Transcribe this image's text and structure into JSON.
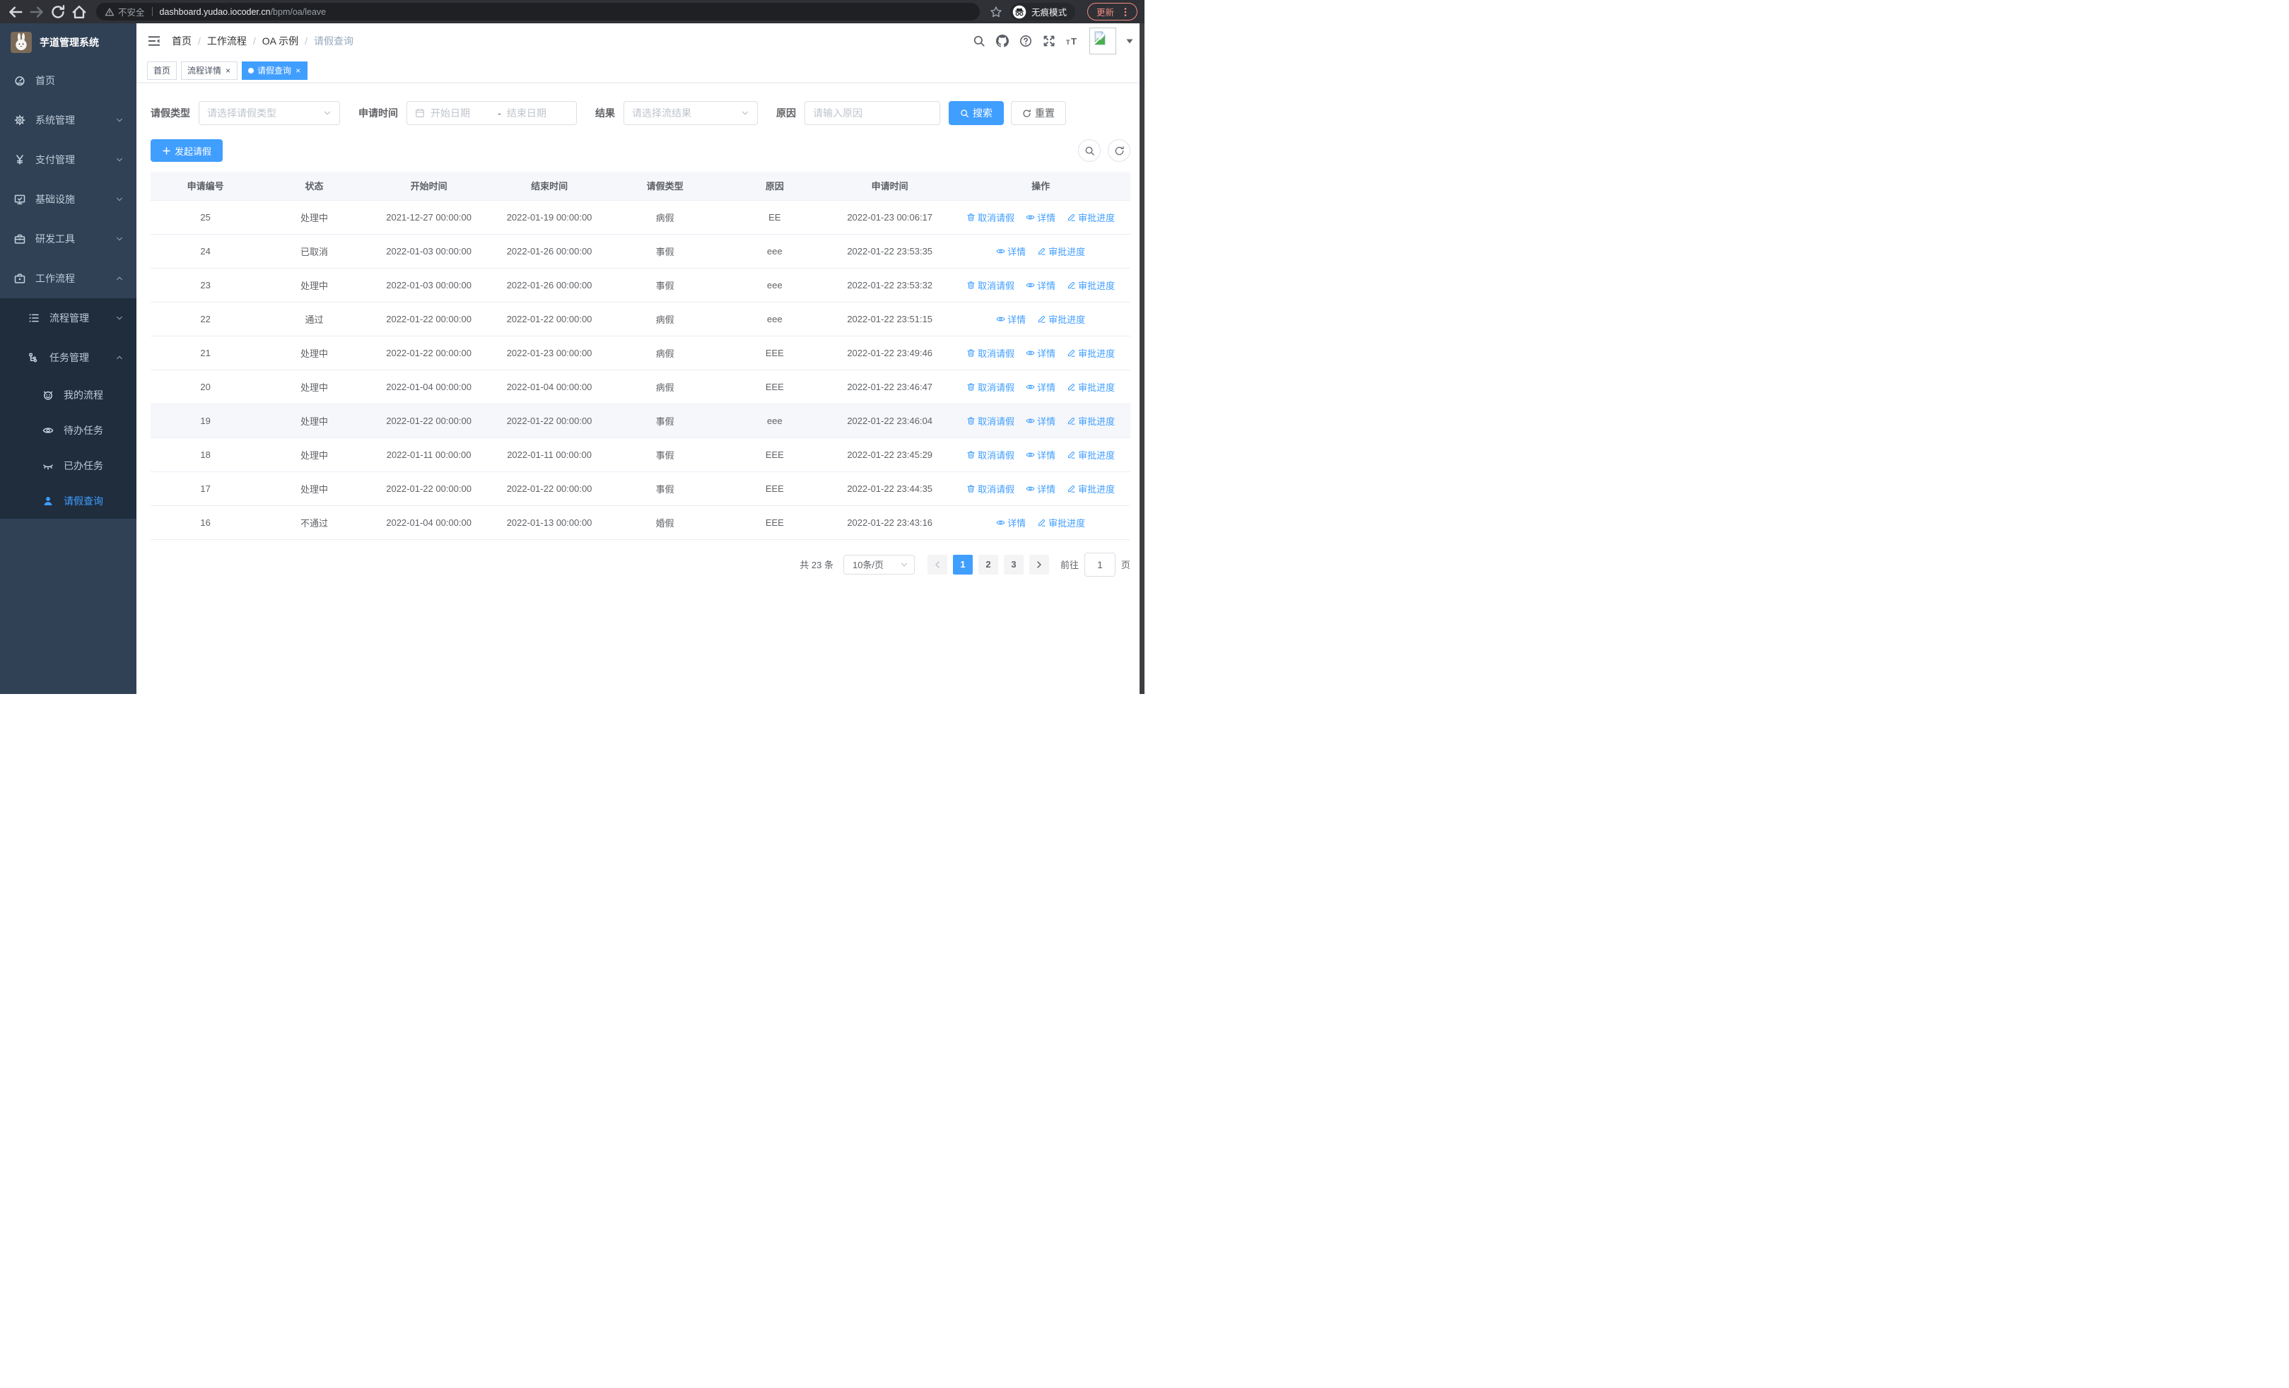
{
  "colors": {
    "accent": "#409eff",
    "sidebar_bg": "#304156",
    "submenu_bg": "#1f2d3d",
    "update_chip": "#f28b82"
  },
  "browser": {
    "security_label": "不安全",
    "url_domain": "dashboard.yudao.iocoder.cn",
    "url_path": "/bpm/oa/leave",
    "incognito_label": "无痕模式",
    "update_label": "更新"
  },
  "sidebar": {
    "title": "芋道管理系统",
    "items": [
      {
        "id": "home",
        "label": "首页",
        "icon": "dashboard-icon",
        "level": 1
      },
      {
        "id": "system-mgmt",
        "label": "系统管理",
        "icon": "gear-icon",
        "level": 1,
        "chevron": "down"
      },
      {
        "id": "pay-mgmt",
        "label": "支付管理",
        "icon": "yen-icon",
        "level": 1,
        "chevron": "down"
      },
      {
        "id": "infrastructure",
        "label": "基础设施",
        "icon": "monitor-icon",
        "level": 1,
        "chevron": "down"
      },
      {
        "id": "dev-tools",
        "label": "研发工具",
        "icon": "toolbox-icon",
        "level": 1,
        "chevron": "down"
      },
      {
        "id": "workflow",
        "label": "工作流程",
        "icon": "briefcase-icon",
        "level": 1,
        "chevron": "up"
      },
      {
        "id": "process-mgmt",
        "label": "流程管理",
        "icon": "flow-list-icon",
        "level": 2,
        "chevron": "down",
        "dark": true
      },
      {
        "id": "task-mgmt",
        "label": "任务管理",
        "icon": "tree-icon",
        "level": 2,
        "chevron": "up",
        "dark": true
      },
      {
        "id": "my-process",
        "label": "我的流程",
        "icon": "robot-icon",
        "level": 3,
        "dark": true
      },
      {
        "id": "todo-task",
        "label": "待办任务",
        "icon": "eye-icon",
        "level": 3,
        "dark": true
      },
      {
        "id": "done-task",
        "label": "已办任务",
        "icon": "eye-closed-icon",
        "level": 3,
        "dark": true
      },
      {
        "id": "leave-query",
        "label": "请假查询",
        "icon": "user-icon",
        "level": 3,
        "dark": true,
        "active": true
      }
    ]
  },
  "navbar": {
    "breadcrumb": [
      "首页",
      "工作流程",
      "OA 示例",
      "请假查询"
    ],
    "separator": "/"
  },
  "tabs": [
    {
      "label": "首页",
      "closable": false,
      "active": false
    },
    {
      "label": "流程详情",
      "closable": true,
      "active": false
    },
    {
      "label": "请假查询",
      "closable": true,
      "active": true
    }
  ],
  "tab_close_glyph": "×",
  "filters": {
    "leave_type": {
      "label": "请假类型",
      "placeholder": "请选择请假类型"
    },
    "apply_time": {
      "label": "申请时间",
      "start_placeholder": "开始日期",
      "separator": "-",
      "end_placeholder": "结束日期"
    },
    "result": {
      "label": "结果",
      "placeholder": "请选择流结果"
    },
    "reason": {
      "label": "原因",
      "placeholder": "请输入原因"
    },
    "search_label": "搜索",
    "reset_label": "重置"
  },
  "toolbar": {
    "create_label": "发起请假"
  },
  "table": {
    "columns": [
      "申请编号",
      "状态",
      "开始时间",
      "结束时间",
      "请假类型",
      "原因",
      "申请时间",
      "操作"
    ],
    "action_defs": {
      "cancel": {
        "name": "cancel-leave-link",
        "icon": "trash-icon",
        "label": "取消请假"
      },
      "detail": {
        "name": "detail-link",
        "icon": "view-icon",
        "label": "详情"
      },
      "progress": {
        "name": "approval-progress-link",
        "icon": "edit-icon",
        "label": "审批进度"
      }
    },
    "rows": [
      {
        "id": "25",
        "status": "处理中",
        "start": "2021-12-27 00:00:00",
        "end": "2022-01-19 00:00:00",
        "type": "病假",
        "reason": "EE",
        "apply_time": "2022-01-23 00:06:17",
        "actions": [
          "cancel",
          "detail",
          "progress"
        ]
      },
      {
        "id": "24",
        "status": "已取消",
        "start": "2022-01-03 00:00:00",
        "end": "2022-01-26 00:00:00",
        "type": "事假",
        "reason": "eee",
        "apply_time": "2022-01-22 23:53:35",
        "actions": [
          "detail",
          "progress"
        ]
      },
      {
        "id": "23",
        "status": "处理中",
        "start": "2022-01-03 00:00:00",
        "end": "2022-01-26 00:00:00",
        "type": "事假",
        "reason": "eee",
        "apply_time": "2022-01-22 23:53:32",
        "actions": [
          "cancel",
          "detail",
          "progress"
        ]
      },
      {
        "id": "22",
        "status": "通过",
        "start": "2022-01-22 00:00:00",
        "end": "2022-01-22 00:00:00",
        "type": "病假",
        "reason": "eee",
        "apply_time": "2022-01-22 23:51:15",
        "actions": [
          "detail",
          "progress"
        ]
      },
      {
        "id": "21",
        "status": "处理中",
        "start": "2022-01-22 00:00:00",
        "end": "2022-01-23 00:00:00",
        "type": "病假",
        "reason": "EEE",
        "apply_time": "2022-01-22 23:49:46",
        "actions": [
          "cancel",
          "detail",
          "progress"
        ]
      },
      {
        "id": "20",
        "status": "处理中",
        "start": "2022-01-04 00:00:00",
        "end": "2022-01-04 00:00:00",
        "type": "病假",
        "reason": "EEE",
        "apply_time": "2022-01-22 23:46:47",
        "actions": [
          "cancel",
          "detail",
          "progress"
        ]
      },
      {
        "id": "19",
        "status": "处理中",
        "start": "2022-01-22 00:00:00",
        "end": "2022-01-22 00:00:00",
        "type": "事假",
        "reason": "eee",
        "apply_time": "2022-01-22 23:46:04",
        "actions": [
          "cancel",
          "detail",
          "progress"
        ],
        "highlighted": true
      },
      {
        "id": "18",
        "status": "处理中",
        "start": "2022-01-11 00:00:00",
        "end": "2022-01-11 00:00:00",
        "type": "事假",
        "reason": "EEE",
        "apply_time": "2022-01-22 23:45:29",
        "actions": [
          "cancel",
          "detail",
          "progress"
        ]
      },
      {
        "id": "17",
        "status": "处理中",
        "start": "2022-01-22 00:00:00",
        "end": "2022-01-22 00:00:00",
        "type": "事假",
        "reason": "EEE",
        "apply_time": "2022-01-22 23:44:35",
        "actions": [
          "cancel",
          "detail",
          "progress"
        ]
      },
      {
        "id": "16",
        "status": "不通过",
        "start": "2022-01-04 00:00:00",
        "end": "2022-01-13 00:00:00",
        "type": "婚假",
        "reason": "EEE",
        "apply_time": "2022-01-22 23:43:16",
        "actions": [
          "detail",
          "progress"
        ]
      }
    ]
  },
  "pagination": {
    "total_label": "共 23 条",
    "page_size_label": "10条/页",
    "pages": [
      "1",
      "2",
      "3"
    ],
    "active_page": "1",
    "goto_label": "前往",
    "goto_value": "1",
    "unit_label": "页"
  }
}
